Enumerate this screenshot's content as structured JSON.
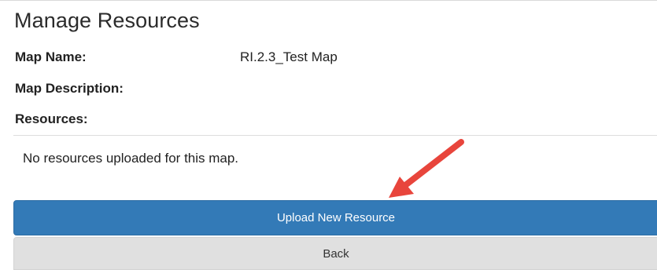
{
  "page": {
    "title": "Manage Resources"
  },
  "fields": {
    "map_name_label": "Map Name:",
    "map_name_value": "RI.2.3_Test Map",
    "map_description_label": "Map Description:",
    "map_description_value": "",
    "resources_label": "Resources:"
  },
  "resources": {
    "empty_message": "No resources uploaded for this map."
  },
  "buttons": {
    "upload_label": "Upload New Resource",
    "back_label": "Back"
  },
  "colors": {
    "primary": "#337ab7",
    "secondary": "#e0e0e0",
    "annotation_arrow": "#e8453c"
  },
  "icons": {
    "annotation": "red-arrow-annotation"
  }
}
